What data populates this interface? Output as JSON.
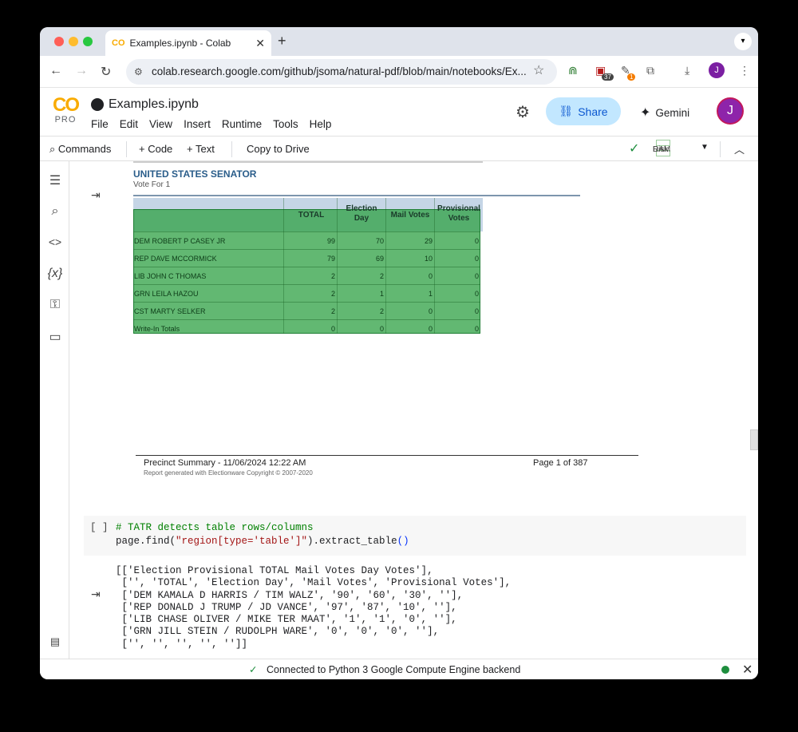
{
  "browser": {
    "tab_title": "Examples.ipynb - Colab",
    "tab_logo": "CO",
    "url": "colab.research.google.com/github/jsoma/natural-pdf/blob/main/notebooks/Ex...",
    "ext_badge_1": "37",
    "ext_badge_2": "1",
    "profile_initial": "J"
  },
  "colab": {
    "logo": "CO",
    "plan": "PRO",
    "notebook_title": "Examples.ipynb",
    "menus": [
      "File",
      "Edit",
      "View",
      "Insert",
      "Runtime",
      "Tools",
      "Help"
    ],
    "share_label": "Share",
    "gemini_label": "Gemini",
    "avatar_initial": "J"
  },
  "cell_toolbar": {
    "commands": "Commands",
    "add_code": "+ Code",
    "add_text": "+ Text",
    "copy_to_drive": "Copy to Drive",
    "ram": "RAM",
    "disk": "Disk"
  },
  "pdf": {
    "heading": "UNITED STATES SENATOR",
    "subheading": "Vote For 1",
    "columns": [
      "TOTAL",
      "Election Day",
      "Mail Votes",
      "Provisional Votes"
    ],
    "rows": [
      {
        "name": "DEM ROBERT P CASEY JR",
        "vals": [
          "99",
          "70",
          "29",
          "0"
        ]
      },
      {
        "name": "REP DAVE MCCORMICK",
        "vals": [
          "79",
          "69",
          "10",
          "0"
        ]
      },
      {
        "name": "LIB JOHN C THOMAS",
        "vals": [
          "2",
          "2",
          "0",
          "0"
        ]
      },
      {
        "name": "GRN LEILA HAZOU",
        "vals": [
          "2",
          "1",
          "1",
          "0"
        ]
      },
      {
        "name": "CST MARTY SELKER",
        "vals": [
          "2",
          "2",
          "0",
          "0"
        ]
      },
      {
        "name": "Write-In Totals",
        "vals": [
          "0",
          "0",
          "0",
          "0"
        ]
      }
    ],
    "footer_left": "Precinct Summary - 11/06/2024    12:22 AM",
    "footer_right": "Page 1 of 387",
    "footer_small": "Report generated with Electionware Copyright © 2007-2020"
  },
  "code_cell": {
    "run_indicator": "[ ]",
    "comment": "# TATR detects table rows/columns",
    "line2_a": "page.find(",
    "line2_str": "\"region[type='table']\"",
    "line2_b": ").extract_table",
    "line2_c": "()"
  },
  "output_lines": [
    "[['Election Provisional TOTAL Mail Votes Day Votes'],",
    " ['', 'TOTAL', 'Election Day', 'Mail Votes', 'Provisional Votes'],",
    " ['DEM KAMALA D HARRIS / TIM WALZ', '90', '60', '30', ''],",
    " ['REP DONALD J TRUMP / JD VANCE', '97', '87', '10', ''],",
    " ['LIB CHASE OLIVER / MIKE TER MAAT', '1', '1', '0', ''],",
    " ['GRN JILL STEIN / RUDOLPH WARE', '0', '0', '0', ''],",
    " ['', '', '', '', '']]"
  ],
  "status": {
    "text": "Connected to Python 3 Google Compute Engine backend"
  }
}
